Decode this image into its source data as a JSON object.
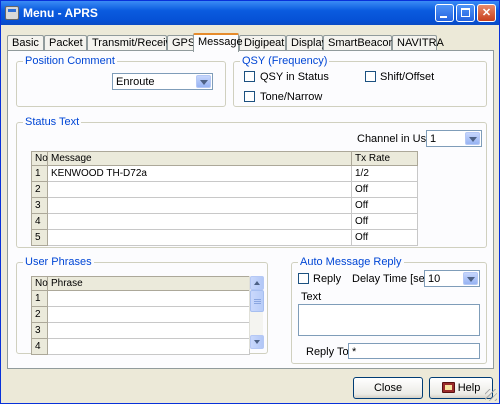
{
  "window": {
    "title": "Menu - APRS"
  },
  "tabs": [
    "Basic",
    "Packet",
    "Transmit/Receive",
    "GPS",
    "Message",
    "Digipeat",
    "Display",
    "SmartBeaconing",
    "NAVITRA"
  ],
  "active_tab": "Message",
  "position_comment": {
    "label": "Position Comment",
    "value": "Enroute"
  },
  "qsy": {
    "label": "QSY (Frequency)",
    "qsy_in_status": "QSY in Status",
    "shift_offset": "Shift/Offset",
    "tone_narrow": "Tone/Narrow"
  },
  "status_text": {
    "label": "Status Text",
    "channel_label": "Channel in Use",
    "channel_value": "1",
    "columns": [
      "No",
      "Message",
      "Tx Rate"
    ],
    "rows": [
      {
        "no": "1",
        "message": "KENWOOD TH-D72a",
        "rate": "1/2"
      },
      {
        "no": "2",
        "message": "",
        "rate": "Off"
      },
      {
        "no": "3",
        "message": "",
        "rate": "Off"
      },
      {
        "no": "4",
        "message": "",
        "rate": "Off"
      },
      {
        "no": "5",
        "message": "",
        "rate": "Off"
      }
    ]
  },
  "user_phrases": {
    "label": "User Phrases",
    "columns": [
      "No",
      "Phrase"
    ],
    "rows": [
      {
        "no": "1",
        "phrase": ""
      },
      {
        "no": "2",
        "phrase": ""
      },
      {
        "no": "3",
        "phrase": ""
      },
      {
        "no": "4",
        "phrase": ""
      }
    ]
  },
  "auto_reply": {
    "label": "Auto Message Reply",
    "reply_label": "Reply",
    "delay_label": "Delay Time [sec]",
    "delay_value": "10",
    "text_label": "Text",
    "reply_to_label": "Reply To",
    "reply_to_value": "*"
  },
  "buttons": {
    "close": "Close",
    "help": "Help"
  },
  "colors": {
    "accent": "#0046d5",
    "titlebar": "#0a5bdf",
    "tab_highlight": "#e68b2c"
  }
}
